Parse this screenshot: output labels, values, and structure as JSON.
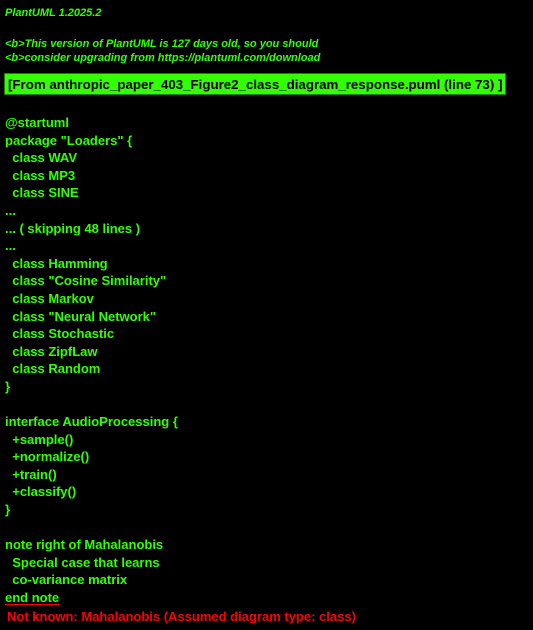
{
  "header": {
    "version": "PlantUML 1.2025.2",
    "notice_line_1": "<b>This version of PlantUML is 127 days old, so you should",
    "notice_line_2": "<b>consider upgrading from https://plantuml.com/download"
  },
  "source_banner": "[From anthropic_paper_403_Figure2_class_diagram_response.puml (line 73) ]",
  "source_lines": [
    "@startuml",
    "package \"Loaders\" {",
    "  class WAV",
    "  class MP3",
    "  class SINE",
    "...",
    "... ( skipping 48 lines )",
    "...",
    "  class Hamming",
    "  class \"Cosine Similarity\"",
    "  class Markov",
    "  class \"Neural Network\"",
    "  class Stochastic",
    "  class ZipfLaw",
    "  class Random",
    "}",
    "",
    "interface AudioProcessing {",
    "  +sample()",
    "  +normalize()",
    "  +train()",
    "  +classify()",
    "}",
    "",
    "note right of Mahalanobis",
    "  Special case that learns",
    "  co-variance matrix",
    "end note"
  ],
  "error_message": "Not known: Mahalanobis (Assumed diagram type: class)",
  "colors": {
    "background": "#000000",
    "text": "#33ff02",
    "banner_background": "#33ff02",
    "banner_text": "#000000",
    "error": "#ff0000"
  }
}
